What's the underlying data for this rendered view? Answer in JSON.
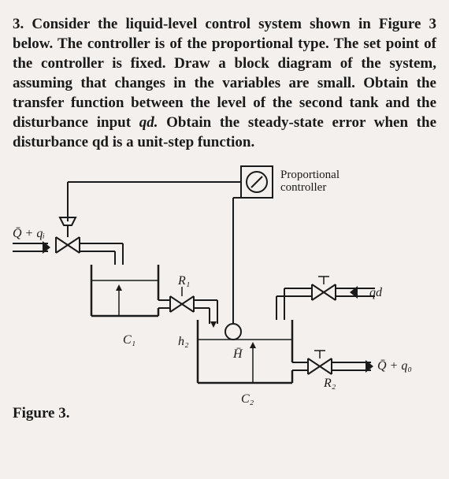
{
  "problem": {
    "number": "3.",
    "text_part1": "Consider the liquid-level control system shown in Figure 3 below. The controller is of the proportional type. The set point of the controller is fixed. Draw a block diagram of the system, assuming that changes in the variables are small. Obtain the transfer function between the level of the second tank and the disturbance input ",
    "var_qd1": "qd.",
    "text_part2": " Obtain the steady-state error when the disturbance qd is a unit-step function."
  },
  "diagram": {
    "controller_label_1": "Proportional",
    "controller_label_2": "controller",
    "inflow_label": "Q̄ + qᵢ",
    "tank1_capacity": "C₁",
    "resistance1": "R₁",
    "h2_label": "h₂",
    "hbar_label": "H̄",
    "disturbance": "qd",
    "tank2_capacity": "C₂",
    "resistance2": "R₂",
    "outflow_label": "Q̄ + q₀"
  },
  "figure_caption": "Figure 3."
}
